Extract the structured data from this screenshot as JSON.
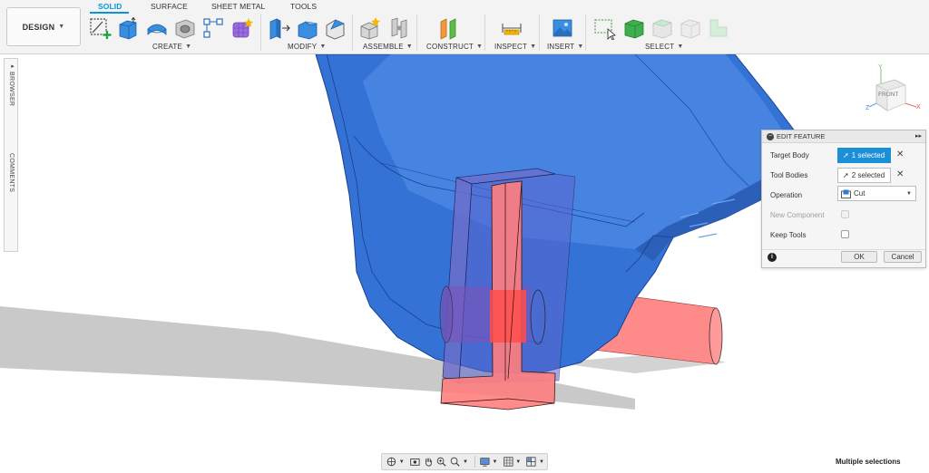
{
  "workspace": {
    "label": "DESIGN"
  },
  "tabs": [
    {
      "label": "SOLID",
      "active": true
    },
    {
      "label": "SURFACE",
      "active": false
    },
    {
      "label": "SHEET METAL",
      "active": false
    },
    {
      "label": "TOOLS",
      "active": false
    }
  ],
  "groups": [
    {
      "label": "CREATE"
    },
    {
      "label": "MODIFY"
    },
    {
      "label": "ASSEMBLE"
    },
    {
      "label": "CONSTRUCT"
    },
    {
      "label": "INSPECT"
    },
    {
      "label": "INSERT"
    },
    {
      "label": "SELECT"
    }
  ],
  "side_panel": {
    "browser": "BROWSER",
    "comments": "COMMENTS"
  },
  "viewcube": {
    "face": "FRONT",
    "axis_y": "Y",
    "axis_x": "X",
    "axis_z": "Z"
  },
  "edit_feature": {
    "title": "EDIT FEATURE",
    "target_body": {
      "label": "Target Body",
      "value": "1 selected"
    },
    "tool_bodies": {
      "label": "Tool Bodies",
      "value": "2 selected"
    },
    "operation": {
      "label": "Operation",
      "value": "Cut"
    },
    "new_component": {
      "label": "New Component",
      "checked": false,
      "enabled": false
    },
    "keep_tools": {
      "label": "Keep Tools",
      "checked": false
    },
    "ok": "OK",
    "cancel": "Cancel"
  },
  "status": "Multiple selections",
  "colors": {
    "accent": "#0696d7",
    "body_blue": "#3a76d8",
    "tool_red": "#ff8080"
  }
}
